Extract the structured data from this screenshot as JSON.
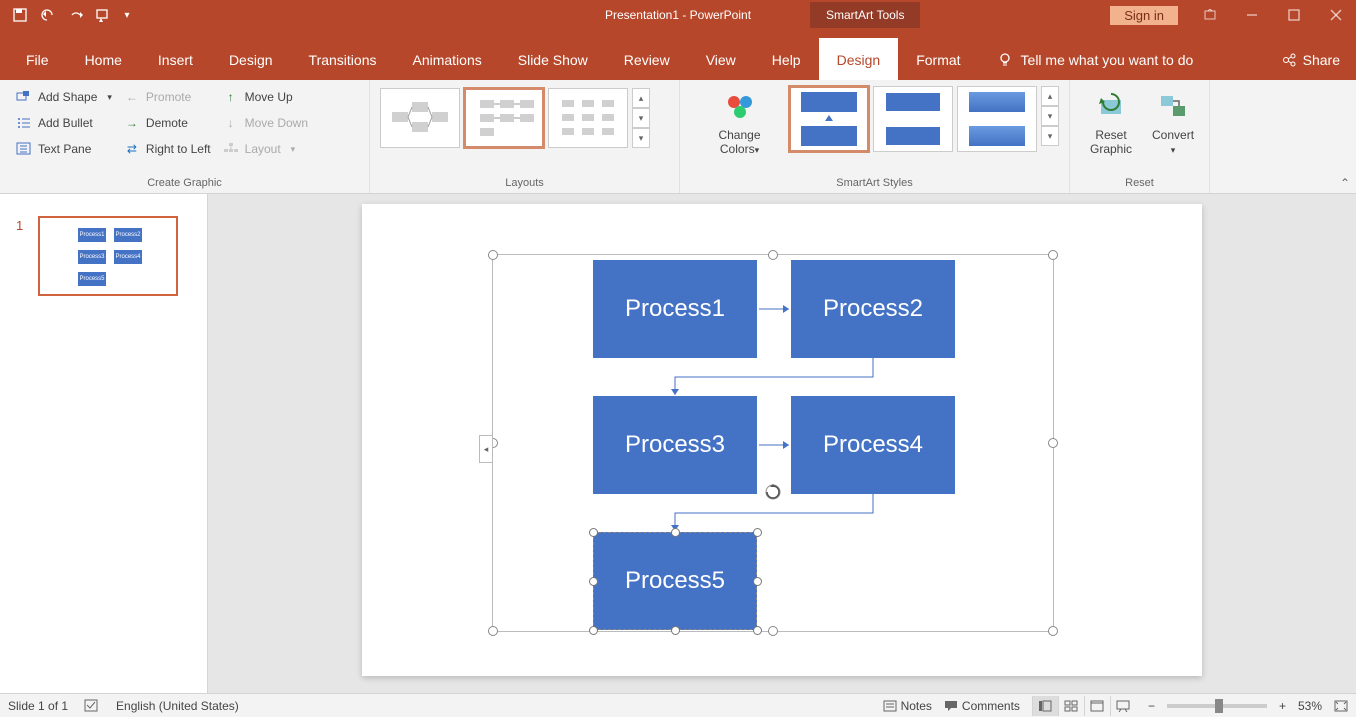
{
  "app": {
    "title": "Presentation1 - PowerPoint",
    "contextTab": "SmartArt Tools",
    "signin": "Sign in"
  },
  "tabs": {
    "file": "File",
    "home": "Home",
    "insert": "Insert",
    "design": "Design",
    "transitions": "Transitions",
    "animations": "Animations",
    "slideshow": "Slide Show",
    "review": "Review",
    "view": "View",
    "help": "Help",
    "saDesign": "Design",
    "format": "Format",
    "tellme": "Tell me what you want to do",
    "share": "Share"
  },
  "ribbon": {
    "createGraphic": {
      "addShape": "Add Shape",
      "addBullet": "Add Bullet",
      "textPane": "Text Pane",
      "promote": "Promote",
      "demote": "Demote",
      "rtl": "Right to Left",
      "moveUp": "Move Up",
      "moveDown": "Move Down",
      "layout": "Layout",
      "label": "Create Graphic"
    },
    "layouts": {
      "label": "Layouts"
    },
    "styles": {
      "changeColors": "Change Colors",
      "label": "SmartArt Styles"
    },
    "reset": {
      "resetGraphic": "Reset Graphic",
      "convert": "Convert",
      "label": "Reset"
    }
  },
  "smartart": {
    "p1": "Process1",
    "p2": "Process2",
    "p3": "Process3",
    "p4": "Process4",
    "p5": "Process5"
  },
  "status": {
    "slide": "Slide 1 of 1",
    "lang": "English (United States)",
    "notes": "Notes",
    "comments": "Comments",
    "zoom": "53%"
  }
}
